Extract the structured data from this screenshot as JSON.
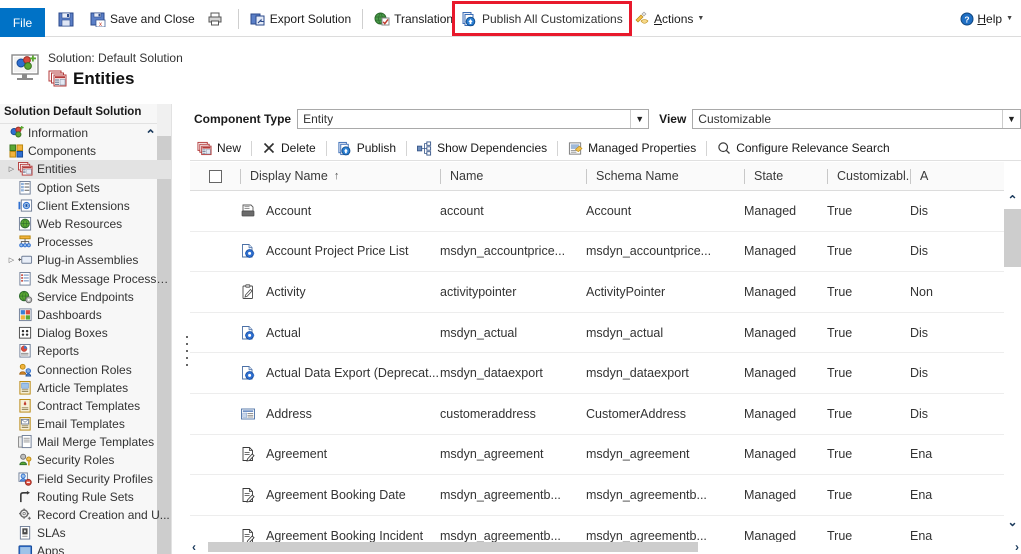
{
  "ribbon": {
    "file_label": "File",
    "items": [
      {
        "label": "",
        "icon": "save-icon",
        "name": "save-button"
      },
      {
        "label": "Save and Close",
        "icon": "save-and-close-icon",
        "name": "save-and-close-button"
      },
      {
        "label": "",
        "icon": "print-icon",
        "name": "print-button"
      },
      {
        "label": "Export Solution",
        "icon": "export-solution-icon",
        "name": "export-solution-button"
      },
      {
        "label": "Translations",
        "icon": "translations-icon",
        "name": "translations-button"
      },
      {
        "label": "Actions",
        "icon": "actions-icon",
        "name": "actions-button"
      }
    ],
    "publish_all_label": "Publish All Customizations",
    "publish_all_icon": "publish-icon",
    "highlight_color": "#e8192c",
    "help_label": "Help",
    "help_icon": "help-icon"
  },
  "header": {
    "solution_line": "Solution: Default Solution",
    "page_title": "Entities",
    "solution_icon": "solution-icon",
    "entities_icon": "entities-icon"
  },
  "sidebar": {
    "title": "Solution Default Solution",
    "items": [
      {
        "label": "Information",
        "icon": "information-icon",
        "expander": "",
        "indent": 0,
        "selected": false
      },
      {
        "label": "Components",
        "icon": "components-icon",
        "expander": "",
        "indent": 0,
        "selected": false
      },
      {
        "label": "Entities",
        "icon": "entities-icon",
        "expander": "▷",
        "indent": 1,
        "selected": true
      },
      {
        "label": "Option Sets",
        "icon": "option-sets-icon",
        "expander": "",
        "indent": 1,
        "selected": false
      },
      {
        "label": "Client Extensions",
        "icon": "client-extensions-icon",
        "expander": "",
        "indent": 1,
        "selected": false
      },
      {
        "label": "Web Resources",
        "icon": "web-resources-icon",
        "expander": "",
        "indent": 1,
        "selected": false
      },
      {
        "label": "Processes",
        "icon": "processes-icon",
        "expander": "",
        "indent": 1,
        "selected": false
      },
      {
        "label": "Plug-in Assemblies",
        "icon": "plugin-assemblies-icon",
        "expander": "▷",
        "indent": 1,
        "selected": false
      },
      {
        "label": "Sdk Message Processin...",
        "icon": "sdk-message-icon",
        "expander": "",
        "indent": 1,
        "selected": false
      },
      {
        "label": "Service Endpoints",
        "icon": "service-endpoints-icon",
        "expander": "",
        "indent": 1,
        "selected": false
      },
      {
        "label": "Dashboards",
        "icon": "dashboards-icon",
        "expander": "",
        "indent": 1,
        "selected": false
      },
      {
        "label": "Dialog Boxes",
        "icon": "dialog-boxes-icon",
        "expander": "",
        "indent": 1,
        "selected": false
      },
      {
        "label": "Reports",
        "icon": "reports-icon",
        "expander": "",
        "indent": 1,
        "selected": false
      },
      {
        "label": "Connection Roles",
        "icon": "connection-roles-icon",
        "expander": "",
        "indent": 1,
        "selected": false
      },
      {
        "label": "Article Templates",
        "icon": "article-templates-icon",
        "expander": "",
        "indent": 1,
        "selected": false
      },
      {
        "label": "Contract Templates",
        "icon": "contract-templates-icon",
        "expander": "",
        "indent": 1,
        "selected": false
      },
      {
        "label": "Email Templates",
        "icon": "email-templates-icon",
        "expander": "",
        "indent": 1,
        "selected": false
      },
      {
        "label": "Mail Merge Templates",
        "icon": "mail-merge-templates-icon",
        "expander": "",
        "indent": 1,
        "selected": false
      },
      {
        "label": "Security Roles",
        "icon": "security-roles-icon",
        "expander": "",
        "indent": 1,
        "selected": false
      },
      {
        "label": "Field Security Profiles",
        "icon": "field-security-profiles-icon",
        "expander": "",
        "indent": 1,
        "selected": false
      },
      {
        "label": "Routing Rule Sets",
        "icon": "routing-rule-sets-icon",
        "expander": "",
        "indent": 1,
        "selected": false
      },
      {
        "label": "Record Creation and U...",
        "icon": "record-creation-icon",
        "expander": "",
        "indent": 1,
        "selected": false
      },
      {
        "label": "SLAs",
        "icon": "slas-icon",
        "expander": "",
        "indent": 1,
        "selected": false
      },
      {
        "label": "Apps",
        "icon": "apps-icon",
        "expander": "",
        "indent": 1,
        "selected": false
      }
    ]
  },
  "filters": {
    "component_type_label": "Component Type",
    "component_type_value": "Entity",
    "view_label": "View",
    "view_value": "Customizable"
  },
  "commands": [
    {
      "label": "New",
      "icon": "new-icon",
      "name": "new-button"
    },
    {
      "label": "Delete",
      "icon": "delete-icon",
      "name": "delete-button"
    },
    {
      "label": "Publish",
      "icon": "publish-icon",
      "name": "publish-button"
    },
    {
      "label": "Show Dependencies",
      "icon": "show-dependencies-icon",
      "name": "show-dependencies-button"
    },
    {
      "label": "Managed Properties",
      "icon": "managed-properties-icon",
      "name": "managed-properties-button"
    },
    {
      "label": "Configure Relevance Search",
      "icon": "search-icon",
      "name": "configure-relevance-search-button"
    }
  ],
  "grid": {
    "columns": [
      {
        "key": "display_name",
        "label": "Display Name",
        "sorted": true,
        "sort_arrow": "↑"
      },
      {
        "key": "name",
        "label": "Name",
        "sorted": false,
        "sort_arrow": ""
      },
      {
        "key": "schema_name",
        "label": "Schema Name",
        "sorted": false,
        "sort_arrow": ""
      },
      {
        "key": "state",
        "label": "State",
        "sorted": false,
        "sort_arrow": ""
      },
      {
        "key": "customizable",
        "label": "Customizabl...",
        "sorted": false,
        "sort_arrow": ""
      },
      {
        "key": "audit",
        "label": "A",
        "sorted": false,
        "sort_arrow": ""
      }
    ],
    "rows": [
      {
        "icon": "account-entity-icon",
        "display_name": "Account",
        "name": "account",
        "schema_name": "Account",
        "state": "Managed",
        "customizable": "True",
        "audit": "Dis"
      },
      {
        "icon": "custom-entity-icon",
        "display_name": "Account Project Price List",
        "name": "msdyn_accountprice...",
        "schema_name": "msdyn_accountprice...",
        "state": "Managed",
        "customizable": "True",
        "audit": "Dis"
      },
      {
        "icon": "activity-entity-icon",
        "display_name": "Activity",
        "name": "activitypointer",
        "schema_name": "ActivityPointer",
        "state": "Managed",
        "customizable": "True",
        "audit": "Non"
      },
      {
        "icon": "custom-entity-icon",
        "display_name": "Actual",
        "name": "msdyn_actual",
        "schema_name": "msdyn_actual",
        "state": "Managed",
        "customizable": "True",
        "audit": "Dis"
      },
      {
        "icon": "custom-entity-icon",
        "display_name": "Actual Data Export (Deprecat...",
        "name": "msdyn_dataexport",
        "schema_name": "msdyn_dataexport",
        "state": "Managed",
        "customizable": "True",
        "audit": "Dis"
      },
      {
        "icon": "address-entity-icon",
        "display_name": "Address",
        "name": "customeraddress",
        "schema_name": "CustomerAddress",
        "state": "Managed",
        "customizable": "True",
        "audit": "Dis"
      },
      {
        "icon": "document-entity-icon",
        "display_name": "Agreement",
        "name": "msdyn_agreement",
        "schema_name": "msdyn_agreement",
        "state": "Managed",
        "customizable": "True",
        "audit": "Ena"
      },
      {
        "icon": "document-entity-icon",
        "display_name": "Agreement Booking Date",
        "name": "msdyn_agreementb...",
        "schema_name": "msdyn_agreementb...",
        "state": "Managed",
        "customizable": "True",
        "audit": "Ena"
      },
      {
        "icon": "document-entity-icon",
        "display_name": "Agreement Booking Incident",
        "name": "msdyn_agreementb...",
        "schema_name": "msdyn_agreementb...",
        "state": "Managed",
        "customizable": "True",
        "audit": "Ena"
      }
    ]
  }
}
